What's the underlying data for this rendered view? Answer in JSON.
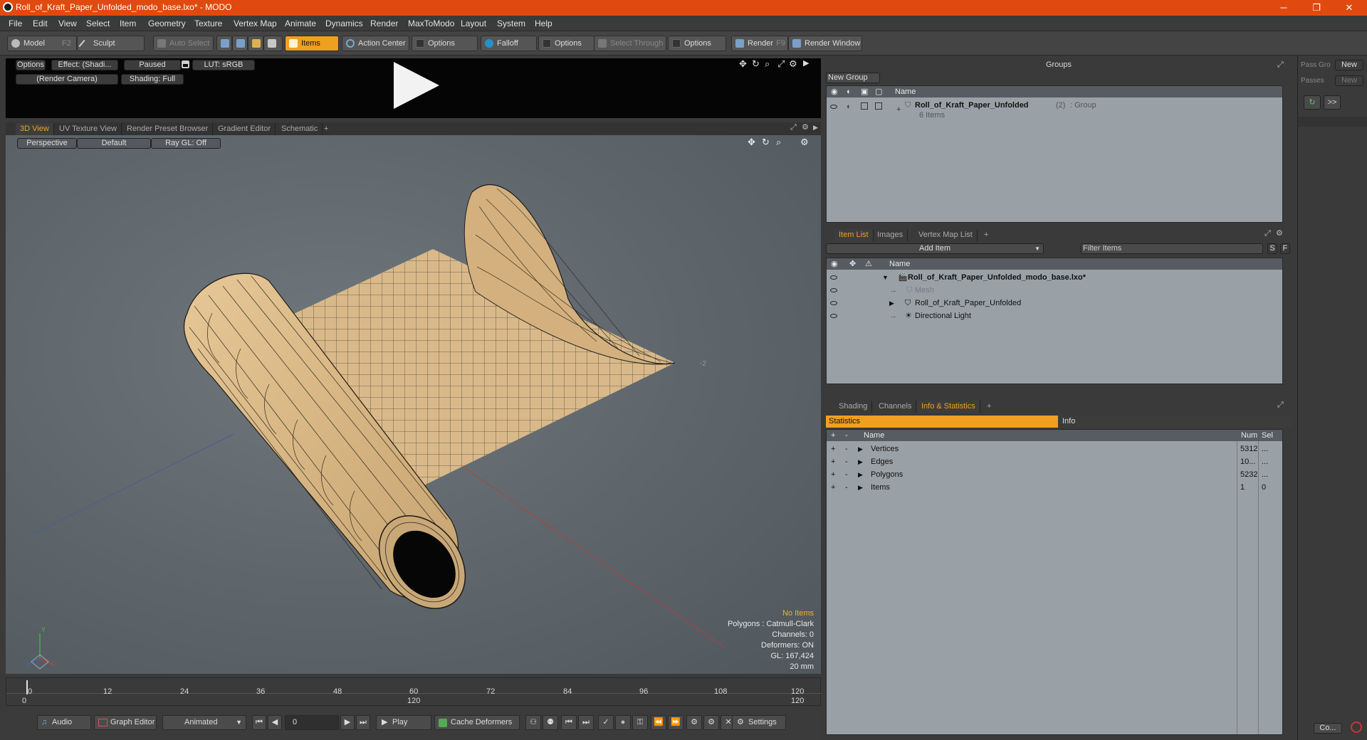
{
  "window": {
    "title": "Roll_of_Kraft_Paper_Unfolded_modo_base.lxo* - MODO",
    "minimize": "─",
    "maximize": "❐",
    "close": "✕"
  },
  "menu": [
    "File",
    "Edit",
    "View",
    "Select",
    "Item",
    "Geometry",
    "Texture",
    "Vertex Map",
    "Animate",
    "Dynamics",
    "Render",
    "MaxToModo",
    "Layout",
    "System",
    "Help"
  ],
  "toolbar": {
    "model": "Model",
    "model_key": "F2",
    "sculpt": "Sculpt",
    "auto_select": "Auto Select",
    "items": "Items",
    "action_center": "Action Center",
    "options1": "Options",
    "falloff": "Falloff",
    "options2": "Options",
    "select_through": "Select Through",
    "options3": "Options",
    "render": "Render",
    "render_key": "F9",
    "render_window": "Render Window"
  },
  "preview": {
    "options": "Options",
    "effect": "Effect: (Shadi...",
    "paused": "Paused",
    "lut": "LUT: sRGB",
    "camera": "(Render Camera)",
    "shading": "Shading: Full"
  },
  "viewport_tabs": [
    "3D View",
    "UV Texture View",
    "Render Preset Browser",
    "Gradient Editor",
    "Schematic",
    "+"
  ],
  "viewport": {
    "perspective": "Perspective",
    "default": "Default",
    "raygl": "Ray GL: Off",
    "axis_label": "-2"
  },
  "vp_info": {
    "no_items": "No Items",
    "polygons": "Polygons : Catmull-Clark",
    "channels": "Channels: 0",
    "deformers": "Deformers: ON",
    "gl": "GL: 167,424",
    "scale": "20 mm"
  },
  "timeline": {
    "ticks": [
      "0",
      "12",
      "24",
      "36",
      "48",
      "60",
      "72",
      "84",
      "96",
      "108",
      "120"
    ],
    "start": "0",
    "mid": "120",
    "end": "120"
  },
  "bottom": {
    "audio": "Audio",
    "graph_editor": "Graph Editor",
    "animated": "Animated",
    "frame": "0",
    "play": "Play",
    "cache": "Cache Deformers",
    "settings": "Settings"
  },
  "groups": {
    "title": "Groups",
    "new_group": "New Group",
    "col_name": "Name",
    "item_name": "Roll_of_Kraft_Paper_Unfolded",
    "item_count": "(2)",
    "item_type": ": Group",
    "item_sub": "6 Items"
  },
  "sidebar": {
    "pass_group": "Pass Gro",
    "passes": "Passes",
    "new1": "New",
    "new2": "New",
    "more": ">>",
    "co": "Co..."
  },
  "itemlist": {
    "tabs": [
      "Item List",
      "Images",
      "Vertex Map List",
      "+"
    ],
    "add_item": "Add Item",
    "filter": "Filter Items",
    "s": "S",
    "f": "F",
    "col_name": "Name",
    "rows": [
      "Roll_of_Kraft_Paper_Unfolded_modo_base.lxo*",
      "Mesh",
      "Roll_of_Kraft_Paper_Unfolded",
      "Directional Light"
    ]
  },
  "stats": {
    "tabs": [
      "Shading",
      "Channels",
      "Info & Statistics",
      "+"
    ],
    "statistics": "Statistics",
    "info": "Info",
    "col_name": "Name",
    "col_num": "Num",
    "col_sel": "Sel",
    "rows": [
      {
        "name": "Vertices",
        "num": "5312",
        "sel": "..."
      },
      {
        "name": "Edges",
        "num": "10...",
        "sel": "..."
      },
      {
        "name": "Polygons",
        "num": "5232",
        "sel": "..."
      },
      {
        "name": "Items",
        "num": "1",
        "sel": "0"
      }
    ]
  },
  "colors": {
    "accent": "#f0a020",
    "titlebar": "#e04a0f",
    "paper": "#d9b98a"
  }
}
